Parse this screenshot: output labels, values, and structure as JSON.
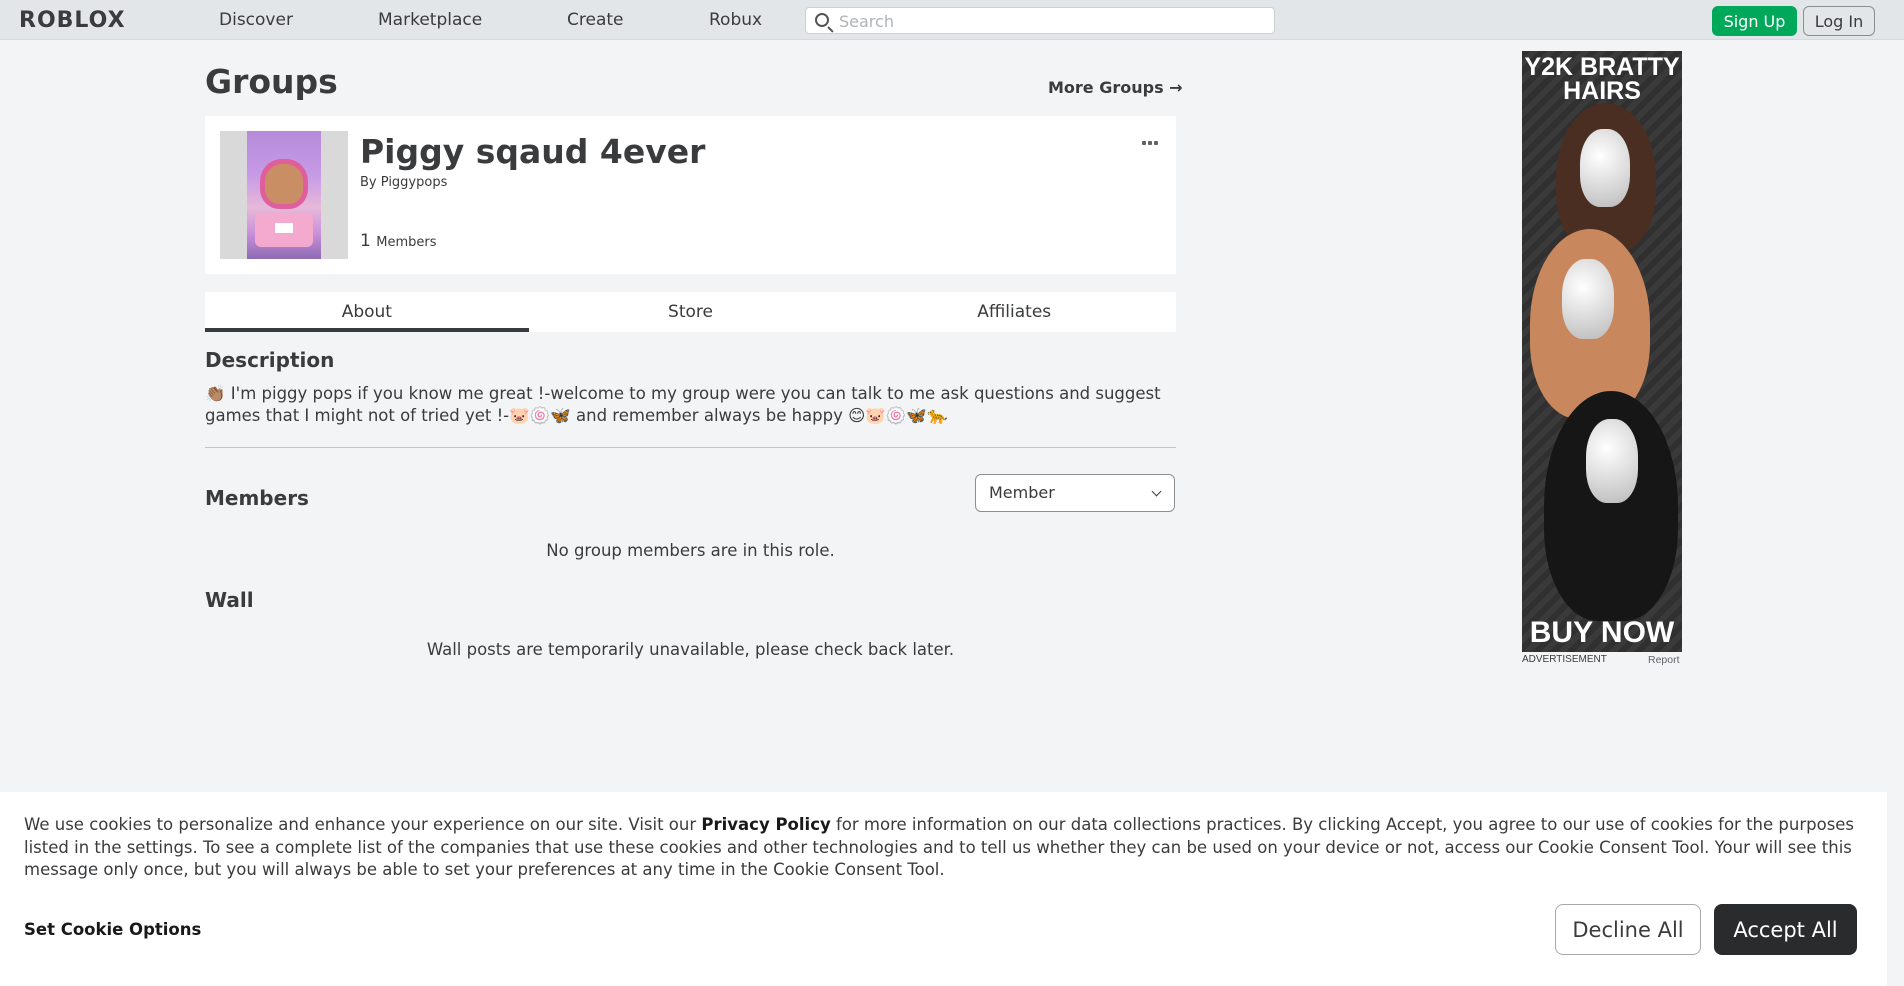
{
  "nav": {
    "logo": "ROBLOX",
    "links": [
      "Discover",
      "Marketplace",
      "Create",
      "Robux"
    ],
    "search_placeholder": "Search",
    "signup": "Sign Up",
    "login": "Log In"
  },
  "page": {
    "title": "Groups",
    "more_groups": "More Groups →"
  },
  "group": {
    "name": "Piggy sqaud 4ever",
    "by_prefix": "By",
    "owner": "Piggypops",
    "member_count": "1",
    "member_label": "Members"
  },
  "tabs": [
    "About",
    "Store",
    "Affiliates"
  ],
  "about": {
    "description_heading": "Description",
    "description_text": "👏🏽 I'm piggy pops if you know me great !-welcome to my group were you can talk to me ask questions and suggest games that I might not of tried yet !-🐷🍥🦋 and remember always be happy 😊🐷🍥🦋🐆",
    "members_heading": "Members",
    "role_selected": "Member",
    "members_empty": "No group members are in this role.",
    "wall_heading": "Wall",
    "wall_empty": "Wall posts are temporarily unavailable, please check back later."
  },
  "ad": {
    "title": "Y2K BRATTY HAIRS",
    "cta": "BUY NOW",
    "label": "ADVERTISEMENT",
    "report": "Report"
  },
  "cookie": {
    "text_before": "We use cookies to personalize and enhance your experience on our site. Visit our ",
    "privacy_link": "Privacy Policy",
    "text_after": " for more information on our data collections practices. By clicking Accept, you agree to our use of cookies for the purposes listed in the settings. To see a complete list of the companies that use these cookies and other technologies and to tell us whether they can be used on your device or not, access our Cookie Consent Tool. Your will see this message only once, but you will always be able to set your preferences at any time in the Cookie Consent Tool.",
    "set_options": "Set Cookie Options",
    "decline": "Decline All",
    "accept": "Accept All"
  }
}
